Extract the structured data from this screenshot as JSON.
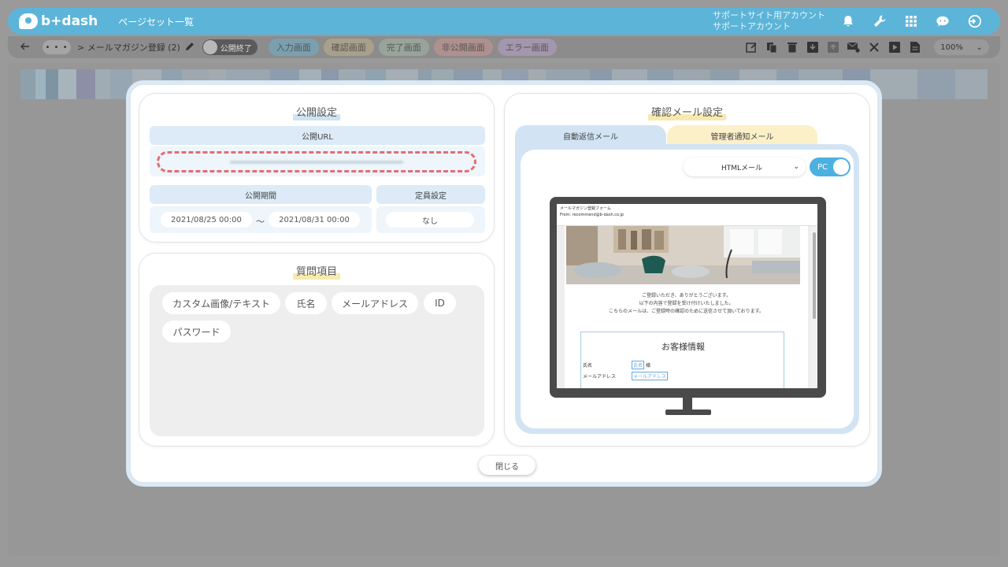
{
  "header": {
    "logo_text": "b+dash",
    "page_set": "ページセット一覧",
    "account_line1": "サポートサイト用アカウント",
    "account_line2": "サポートアカウント"
  },
  "toolbar": {
    "more": "• • •",
    "breadcrumb": "> メールマガジン登録 (2)",
    "publish_toggle": "公開終了",
    "tabs": [
      "入力画面",
      "確認画面",
      "完了画面",
      "非公開画面",
      "エラー画面"
    ],
    "zoom": "100%"
  },
  "publish": {
    "title": "公開設定",
    "url_label": "公開URL",
    "period_label": "公開期間",
    "start": "2021/08/25 00:00",
    "tilde": "～",
    "end": "2021/08/31 00:00",
    "capacity_label": "定員設定",
    "capacity_value": "なし"
  },
  "questions": {
    "title": "質問項目",
    "items": [
      "カスタム画像/テキスト",
      "氏名",
      "メールアドレス",
      "ID",
      "パスワード"
    ]
  },
  "confirm_mail": {
    "title": "確認メール設定",
    "tab_auto": "自動返信メール",
    "tab_admin": "管理者通知メール",
    "format": "HTMLメール",
    "device": "PC",
    "email": {
      "subject": "メールマガジン登録フォーム",
      "from": "From: recommend@b-dash.co.jp",
      "line1": "ご登録いただき、ありがとうございます。",
      "line2": "以下の内容で登録を受け付けいたしました。",
      "line3": "こちらのメールは、ご登録時の確認のために送信させて頂いております。",
      "info_title": "お客様情報",
      "row1_key": "氏名",
      "row1_value": "氏名",
      "row1_suffix": "様",
      "row2_key": "メールアドレス",
      "row2_value": "メールアドレス"
    }
  },
  "close_label": "閉じる",
  "colors": {
    "header": "#5cb4d8",
    "modal_border": "#dbe9f4",
    "url_dashed": "#e26e72",
    "pc_toggle": "#4bb1e0"
  }
}
